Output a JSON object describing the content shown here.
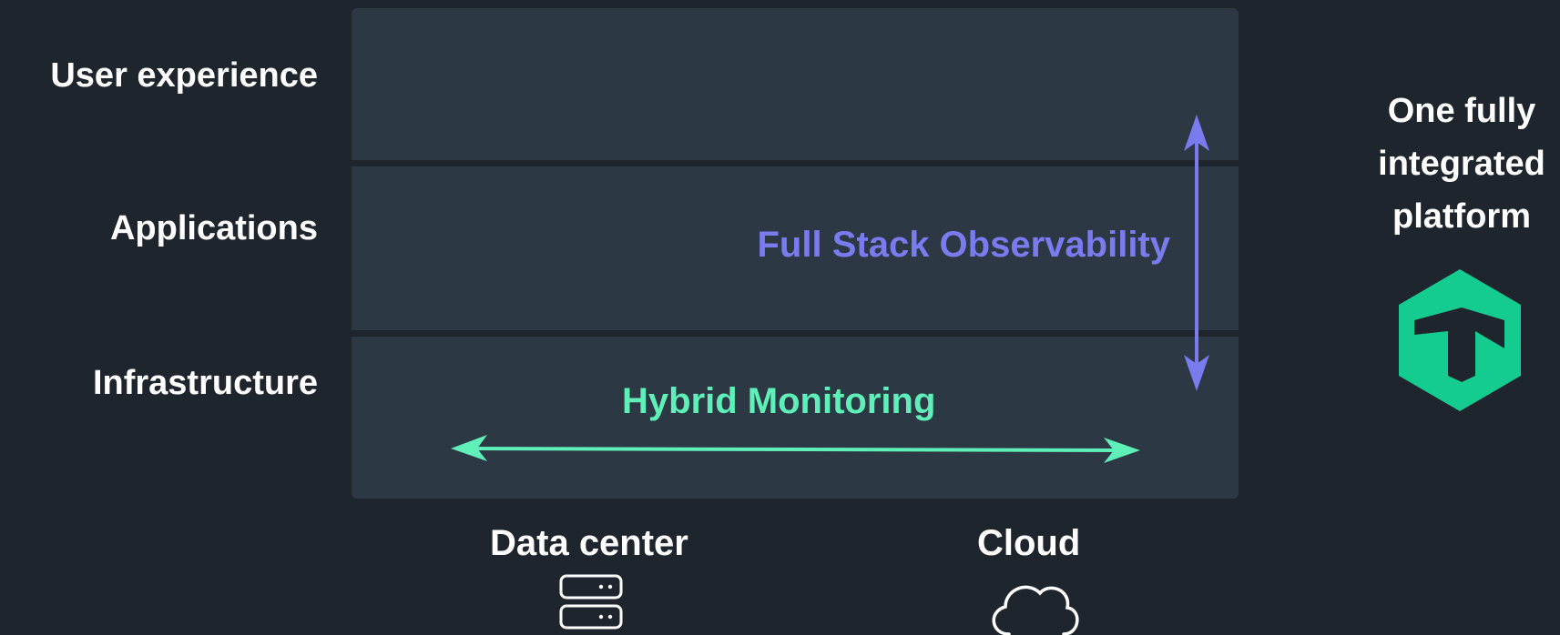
{
  "layers": [
    {
      "label": "User experience"
    },
    {
      "label": "Applications"
    },
    {
      "label": "Infrastructure"
    }
  ],
  "full_stack": {
    "label": "Full Stack Observability",
    "color": "#7b7bf0"
  },
  "hybrid": {
    "label": "Hybrid Monitoring",
    "color": "#5ef0b8"
  },
  "locations": [
    {
      "label": "Data center",
      "icon": "server-icon"
    },
    {
      "label": "Cloud",
      "icon": "cloud-icon"
    }
  ],
  "platform": {
    "lines": [
      "One fully",
      "integrated",
      "platform"
    ],
    "logo_icon": "hexagon-logo-icon",
    "logo_color": "#14cc90"
  },
  "colors": {
    "background": "#1f252d",
    "band": "#2d3845"
  }
}
